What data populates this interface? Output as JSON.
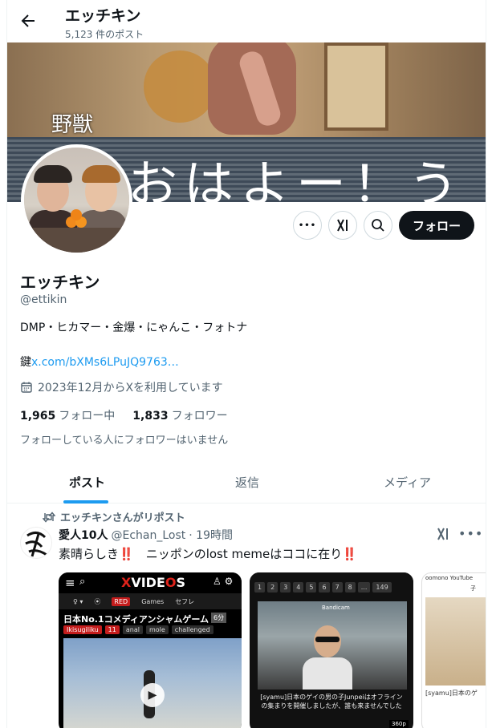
{
  "header": {
    "title": "エッチキン",
    "post_count": "5,123 件のポスト"
  },
  "banner": {
    "text_large": "おはよー！うんこ",
    "text_small": "野獣"
  },
  "actions": {
    "more": "•••",
    "follow_label": "フォロー"
  },
  "profile": {
    "name": "エッチキン",
    "handle": "@ettikin",
    "bio": "DMP・ヒカマー・金爆・にゃんこ・フォトナ",
    "link_prefix": "鍵",
    "link_text": "x.com/bXMs6LPuJQ9763…",
    "joined": "2023年12月からXを利用しています",
    "following_count": "1,965",
    "following_label": "フォロー中",
    "followers_count": "1,833",
    "followers_label": "フォロワー",
    "followers_note": "フォローしている人にフォロワーはいません"
  },
  "tabs": [
    {
      "label": "ポスト",
      "active": true
    },
    {
      "label": "返信",
      "active": false
    },
    {
      "label": "メディア",
      "active": false
    }
  ],
  "tweet": {
    "repost_label": "エッチキンさんがリポスト",
    "author_name": "愛人10人",
    "author_handle": "@Echan_Lost",
    "time": "· 19時間",
    "more": "•••",
    "text_part1": "素晴らしき",
    "text_mark1": "‼️",
    "text_part2": "　ニッポンのlost memeはココに在り",
    "text_mark2": "‼️",
    "media": [
      {
        "logo_x": "X",
        "logo_vide": "VIDE",
        "logo_o": "O",
        "logo_s": "S",
        "nav": [
          "♀ ▾",
          "⦿",
          "RED",
          "Games",
          "セフレ"
        ],
        "title": "日本No.1コメディアンシャムゲーム",
        "duration": "6分",
        "tags": [
          "Ikisugiliku",
          "11",
          "anal",
          "mole",
          "challenged"
        ]
      },
      {
        "pages": [
          "1",
          "2",
          "3",
          "4",
          "5",
          "6",
          "7",
          "8",
          "...",
          "149"
        ],
        "watermark": "Bandicam",
        "caption": "[syamu]日本のゲイの男の子Junpeiはオフラインの集まりを開催しましたが、誰も来ませんでした",
        "resolution": "360p"
      },
      {
        "header": "oomono YouTube",
        "header2": "子",
        "caption": "[syamu]日本のゲ"
      }
    ]
  }
}
